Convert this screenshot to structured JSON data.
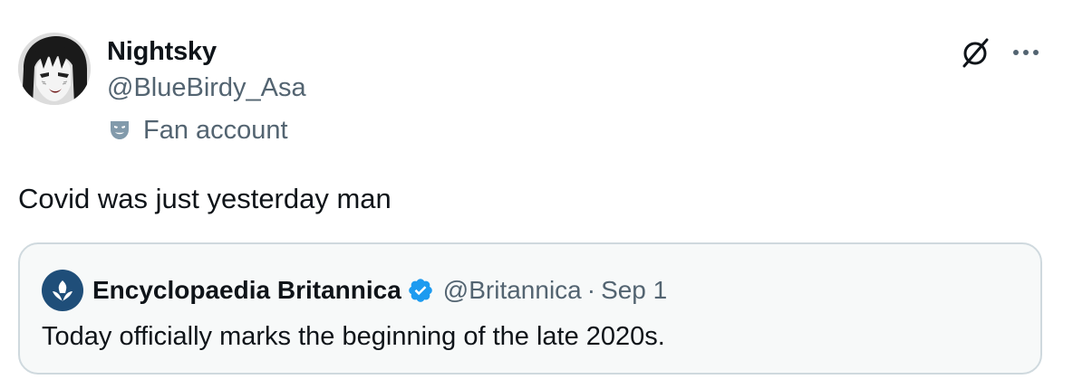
{
  "author": {
    "display_name": "Nightsky",
    "handle": "@BlueBirdy_Asa",
    "label_icon": "theater-mask-icon",
    "label_text": "Fan account",
    "avatar_icon": "anime-avatar"
  },
  "actions": {
    "grok_icon": "grok-slash-icon",
    "more_icon": "more-horizontal-icon"
  },
  "tweet": {
    "text": "Covid was just yesterday man"
  },
  "quoted_tweet": {
    "display_name": "Encyclopaedia Britannica",
    "verified": true,
    "verified_color": "#1d9bf0",
    "handle": "@Britannica",
    "separator": "·",
    "date": "Sep 1",
    "text": "Today officially marks the beginning of the late 2020s.",
    "avatar_color": "#1f4e79"
  },
  "colors": {
    "primary_text": "#0f1419",
    "secondary_text": "#536471",
    "border": "#cfd9de",
    "quote_bg": "#f7f9f9"
  }
}
